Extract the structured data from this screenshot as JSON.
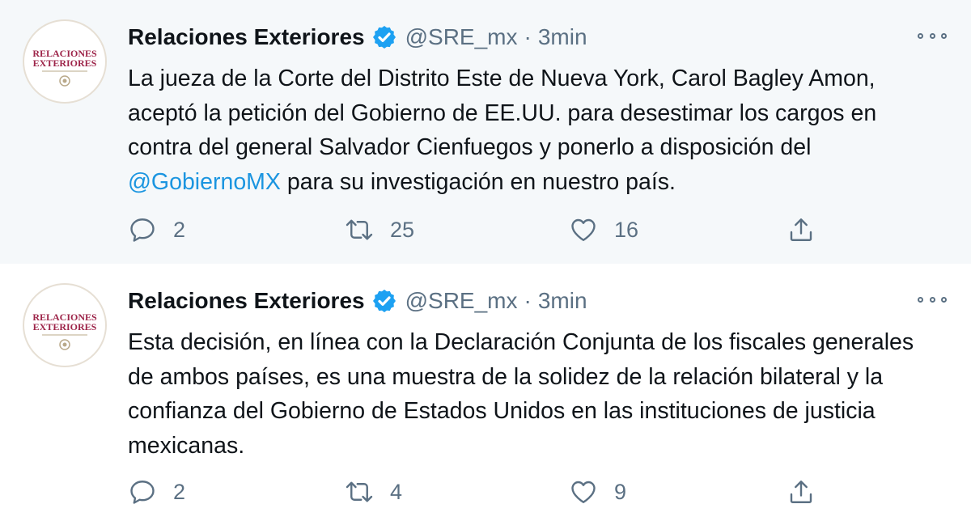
{
  "thread": [
    {
      "author": {
        "name": "Relaciones Exteriores",
        "handle": "@SRE_mx",
        "separator": "·",
        "time": "3min",
        "avatar_logo_text": [
          "RELACIONES",
          "EXTERIORES"
        ]
      },
      "text_before_mention": "La jueza de la Corte del Distrito Este de Nueva York, Carol Bagley Amon, aceptó la petición del Gobierno de EE.UU. para desestimar los cargos en contra del general Salvador Cienfuegos y ponerlo a disposición del ",
      "mention": "@GobiernoMX",
      "text_after_mention": " para su investigación en nuestro país.",
      "stats": {
        "replies": "2",
        "retweets": "25",
        "likes": "16"
      }
    },
    {
      "author": {
        "name": "Relaciones Exteriores",
        "handle": "@SRE_mx",
        "separator": "·",
        "time": "3min",
        "avatar_logo_text": [
          "RELACIONES",
          "EXTERIORES"
        ]
      },
      "text": "Esta decisión, en línea con la Declaración Conjunta de los fiscales generales de ambos países, es una muestra de la solidez de la relación bilateral y la confianza del Gobierno de Estados Unidos en las instituciones de justicia mexicanas.",
      "stats": {
        "replies": "2",
        "retweets": "4",
        "likes": "9"
      }
    }
  ],
  "icons": [
    "verified-badge-icon",
    "more-options-icon",
    "reply-icon",
    "retweet-icon",
    "like-icon",
    "share-icon"
  ],
  "colors": {
    "verified": "#1da1f2",
    "mention": "#1b95e0",
    "secondary_text": "#5b7083",
    "highlight_background": "#f5f8fa",
    "logo_text": "#9d2449"
  }
}
